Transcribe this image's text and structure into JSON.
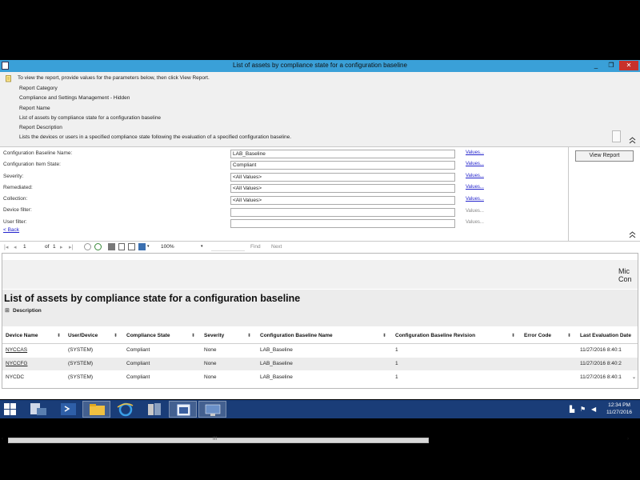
{
  "window": {
    "title": "List of assets by compliance state for a configuration baseline",
    "min_glyph": "_",
    "restore_glyph": "❐",
    "close_glyph": "✕"
  },
  "info": {
    "instruction": "To view the report, provide values for the parameters below, then click View Report.",
    "category_label": "Report Category",
    "category_value": "Compliance and Settings Management - Hidden",
    "name_label": "Report Name",
    "name_value": "List of assets by compliance state for a configuration baseline",
    "desc_label": "Report Description",
    "desc_value": "Lists the devices or users in a specified compliance state following the evaluation of a specified configuration baseline."
  },
  "params": {
    "items": [
      {
        "label": "Configuration Baseline Name:",
        "value": "LAB_Baseline",
        "link": "Values..."
      },
      {
        "label": "Configuration Item State:",
        "value": "Compliant",
        "link": "Values..."
      },
      {
        "label": "Severity:",
        "value": "<All Values>",
        "link": "Values..."
      },
      {
        "label": "Remediated:",
        "value": "<All Values>",
        "link": "Values..."
      },
      {
        "label": "Collection:",
        "value": "<All Values>",
        "link": "Values..."
      },
      {
        "label": "Device filter:",
        "value": "",
        "link": "Values..."
      },
      {
        "label": "User filter:",
        "value": "",
        "link": "Values..."
      }
    ],
    "back_link": "< Back",
    "view_report": "View Report"
  },
  "toolbar": {
    "page": "1",
    "of_label": "of",
    "total_pages": "1",
    "zoom": "100%",
    "find": "Find",
    "next": "Next"
  },
  "report": {
    "logo_line1": "Mic",
    "logo_line2": "Con",
    "title": "List of assets by compliance state for a configuration baseline",
    "description_toggle": "⊞",
    "description_label": "Description",
    "columns": [
      "Device Name",
      "User/Device",
      "Compliance State",
      "Severity",
      "Configuration Baseline Name",
      "Configuration Baseline Revision",
      "Error Code",
      "Last Evaluation Date"
    ],
    "rows": [
      [
        "NYCCAS",
        "(SYSTEM)",
        "Compliant",
        "None",
        "LAB_Baseline",
        "1",
        "",
        "11/27/2016 8:40:1"
      ],
      [
        "NYCCFG",
        "(SYSTEM)",
        "Compliant",
        "None",
        "LAB_Baseline",
        "1",
        "",
        "11/27/2016 8:40:2"
      ],
      [
        "NYCDC",
        "(SYSTEM)",
        "Compliant",
        "None",
        "LAB_Baseline",
        "1",
        "",
        "11/27/2016 8:40:1"
      ]
    ],
    "hscroll_glyph": "III"
  },
  "taskbar": {
    "time": "12:34 PM",
    "date": "11/27/2016"
  },
  "colors": {
    "title_bar": "#3aa0d8",
    "taskbar": "#1a3d78",
    "link": "#2222cc",
    "close": "#c8312b"
  }
}
